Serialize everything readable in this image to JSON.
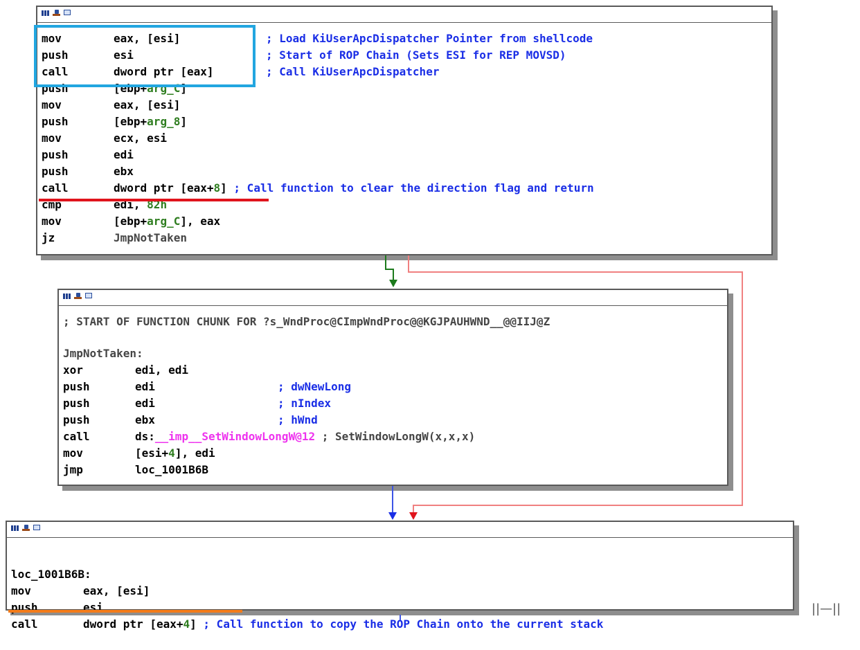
{
  "colors": {
    "highlight_blue": "#22a6e0",
    "highlight_red": "#e0141c",
    "highlight_orange": "#f47c1a",
    "edge_green": "#1c7a1c",
    "edge_red": "#f08080",
    "edge_blue": "#3d55e6",
    "comment_blue": "#1a2ee6",
    "operand_green": "#2e7d1f",
    "import_pink": "#ee33ee"
  },
  "header_icons": [
    "graph-view-icon",
    "edit-icon",
    "window-icon"
  ],
  "block1": {
    "lines": [
      {
        "m": "mov",
        "op": "eax, [esi]",
        "c": "; Load KiUserApcDispatcher Pointer from shellcode"
      },
      {
        "m": "push",
        "op": "esi",
        "c": "; Start of ROP Chain (Sets ESI for REP MOVSD)"
      },
      {
        "m": "call",
        "op": "dword ptr [eax]",
        "c": "; Call KiUserApcDispatcher"
      },
      {
        "m": "push",
        "op_pre": "[ebp+",
        "op_g": "arg_C",
        "op_post": "]"
      },
      {
        "m": "mov",
        "op": "eax, [esi]"
      },
      {
        "m": "push",
        "op_pre": "[ebp+",
        "op_g": "arg_8",
        "op_post": "]"
      },
      {
        "m": "mov",
        "op": "ecx, esi"
      },
      {
        "m": "push",
        "op": "edi"
      },
      {
        "m": "push",
        "op": "ebx"
      },
      {
        "m": "call",
        "op_pre": "dword ptr [eax+",
        "op_g": "8",
        "op_post": "]",
        "c": " ; Call function to clear the direction flag and return"
      },
      {
        "m": "cmp",
        "op_pre": "edi, ",
        "op_g": "82h"
      },
      {
        "m": "mov",
        "op_pre": "[ebp+",
        "op_g": "arg_C",
        "op_post": "], eax"
      },
      {
        "m": "jz",
        "op_gray": "JmpNotTaken"
      }
    ]
  },
  "block2": {
    "chunk_comment": "; START OF FUNCTION CHUNK FOR ?s_WndProc@CImpWndProc@@KGJPAUHWND__@@IIJ@Z",
    "label": "JmpNotTaken:",
    "lines": [
      {
        "m": "xor",
        "op": "edi, edi"
      },
      {
        "m": "push",
        "op": "edi",
        "c": "; dwNewLong"
      },
      {
        "m": "push",
        "op": "edi",
        "c": "; nIndex"
      },
      {
        "m": "push",
        "op": "ebx",
        "c": "; hWnd"
      },
      {
        "m": "call",
        "op": "ds:",
        "op_pink": "__imp__SetWindowLongW@12",
        "c_gray": " ; SetWindowLongW(x,x,x)"
      },
      {
        "m": "mov",
        "op_pre": "[esi+",
        "op_g": "4",
        "op_post": "], edi"
      },
      {
        "m": "jmp",
        "op": "loc_1001B6B"
      }
    ]
  },
  "block3": {
    "label": "loc_1001B6B:",
    "lines": [
      {
        "m": "mov",
        "op": "eax, [esi]"
      },
      {
        "m": "push",
        "op": "esi"
      },
      {
        "m": "call",
        "op_pre": "dword ptr [eax+",
        "op_g": "4",
        "op_post": "]",
        "c": " ; Call function to copy the ROP Chain onto the current stack"
      }
    ]
  },
  "corner_glyph": "||—||"
}
